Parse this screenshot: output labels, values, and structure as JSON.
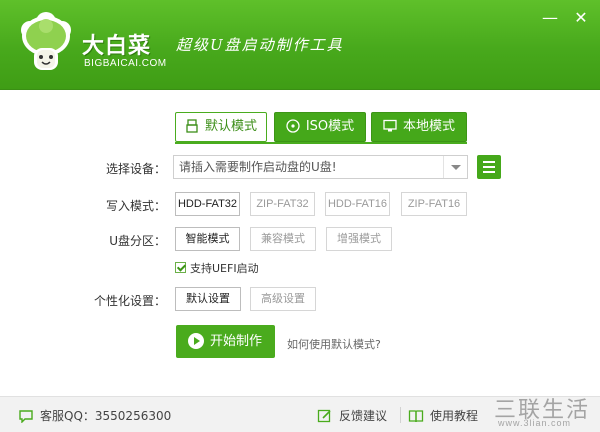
{
  "header": {
    "logo_text": "大白菜",
    "logo_sub": "BIGBAICAI.COM",
    "slogan": "超级U盘启动制作工具",
    "minimize_glyph": "—",
    "close_glyph": "✕"
  },
  "tabs": [
    {
      "label": "默认模式",
      "active": true,
      "icon": "usb-icon"
    },
    {
      "label": "ISO模式",
      "active": false,
      "icon": "disc-icon"
    },
    {
      "label": "本地模式",
      "active": false,
      "icon": "monitor-icon"
    }
  ],
  "form": {
    "device_label": "选择设备：",
    "device_value": "请插入需要制作启动盘的U盘!",
    "write_mode_label": "写入模式：",
    "write_modes": [
      "HDD-FAT32",
      "ZIP-FAT32",
      "HDD-FAT16",
      "ZIP-FAT16"
    ],
    "write_mode_selected": "HDD-FAT32",
    "partition_label": "U盘分区：",
    "partition_modes": [
      "智能模式",
      "兼容模式",
      "增强模式"
    ],
    "partition_selected": "智能模式",
    "uefi_label": "支持UEFI启动",
    "uefi_checked": true,
    "custom_label": "个性化设置：",
    "custom_modes": [
      "默认设置",
      "高级设置"
    ],
    "custom_selected": "默认设置",
    "start_button": "开始制作",
    "help_link": "如何使用默认模式?"
  },
  "footer": {
    "service": "客服QQ：3550256300",
    "feedback": "反馈建议",
    "tutorial": "使用教程",
    "watermark_big": "三联生活",
    "watermark_small": "www.3lian.com"
  },
  "colors": {
    "brand_green": "#4aab1d",
    "header_light": "#5fc02a",
    "header_dark": "#3f9d15"
  }
}
